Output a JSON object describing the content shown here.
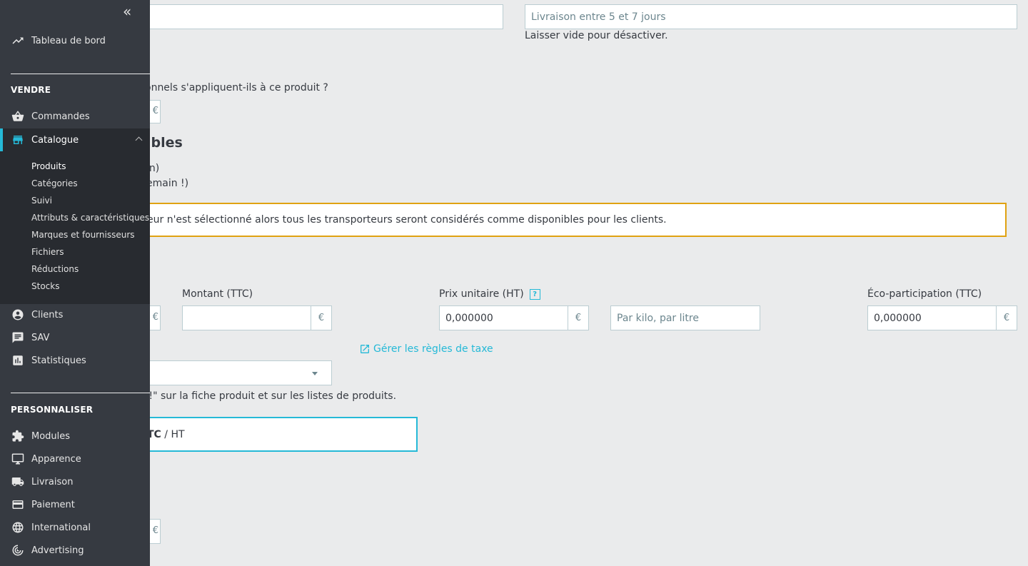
{
  "sidebar": {
    "collapse_glyph": "«",
    "dashboard": "Tableau de bord",
    "section_sell": "VENDRE",
    "orders": "Commandes",
    "catalog": "Catalogue",
    "catalog_sub": [
      "Produits",
      "Catégories",
      "Suivi",
      "Attributs & caractéristiques",
      "Marques et fournisseurs",
      "Fichiers",
      "Réductions",
      "Stocks"
    ],
    "customers": "Clients",
    "sav": "SAV",
    "stats": "Statistiques",
    "section_customize": "PERSONNALISER",
    "modules": "Modules",
    "appearance": "Apparence",
    "shipping": "Livraison",
    "payment": "Paiement",
    "international": "International",
    "advertising": "Advertising",
    "accent_color": "#25b9d7"
  },
  "main": {
    "delivery_time_value": "Livraison entre 5 et 7 jours",
    "delivery_help": "Laisser vide pour désactiver.",
    "additional_fees_question": "onnels s'appliquent-ils à ce produit ?",
    "carriers_heading": "ibles",
    "carrier_line1": "in)",
    "carrier_line2": "emain !)",
    "carrier_warning": "eur n'est sélectionné alors tous les transporteurs seront considérés comme disponibles pour les clients.",
    "amount_ttc_label": "Montant (TTC)",
    "amount_ttc_value": "",
    "unit_price_label": "Prix unitaire (HT)",
    "help_glyph": "?",
    "unit_price_value": "0,000000",
    "unity_placeholder": "Par kilo, par litre",
    "eco_label": "Éco-participation (TTC)",
    "eco_value": "0,000000",
    "currency": "€",
    "cut_currency": "€",
    "tax_rules_link": "Gérer les règles de taxe",
    "tax_select_value": "",
    "on_sale_text": ")!\" sur la fiche produit et sur les listes de produits.",
    "price_ttc": "TC",
    "price_sep": " / ",
    "price_ht": "HT"
  }
}
